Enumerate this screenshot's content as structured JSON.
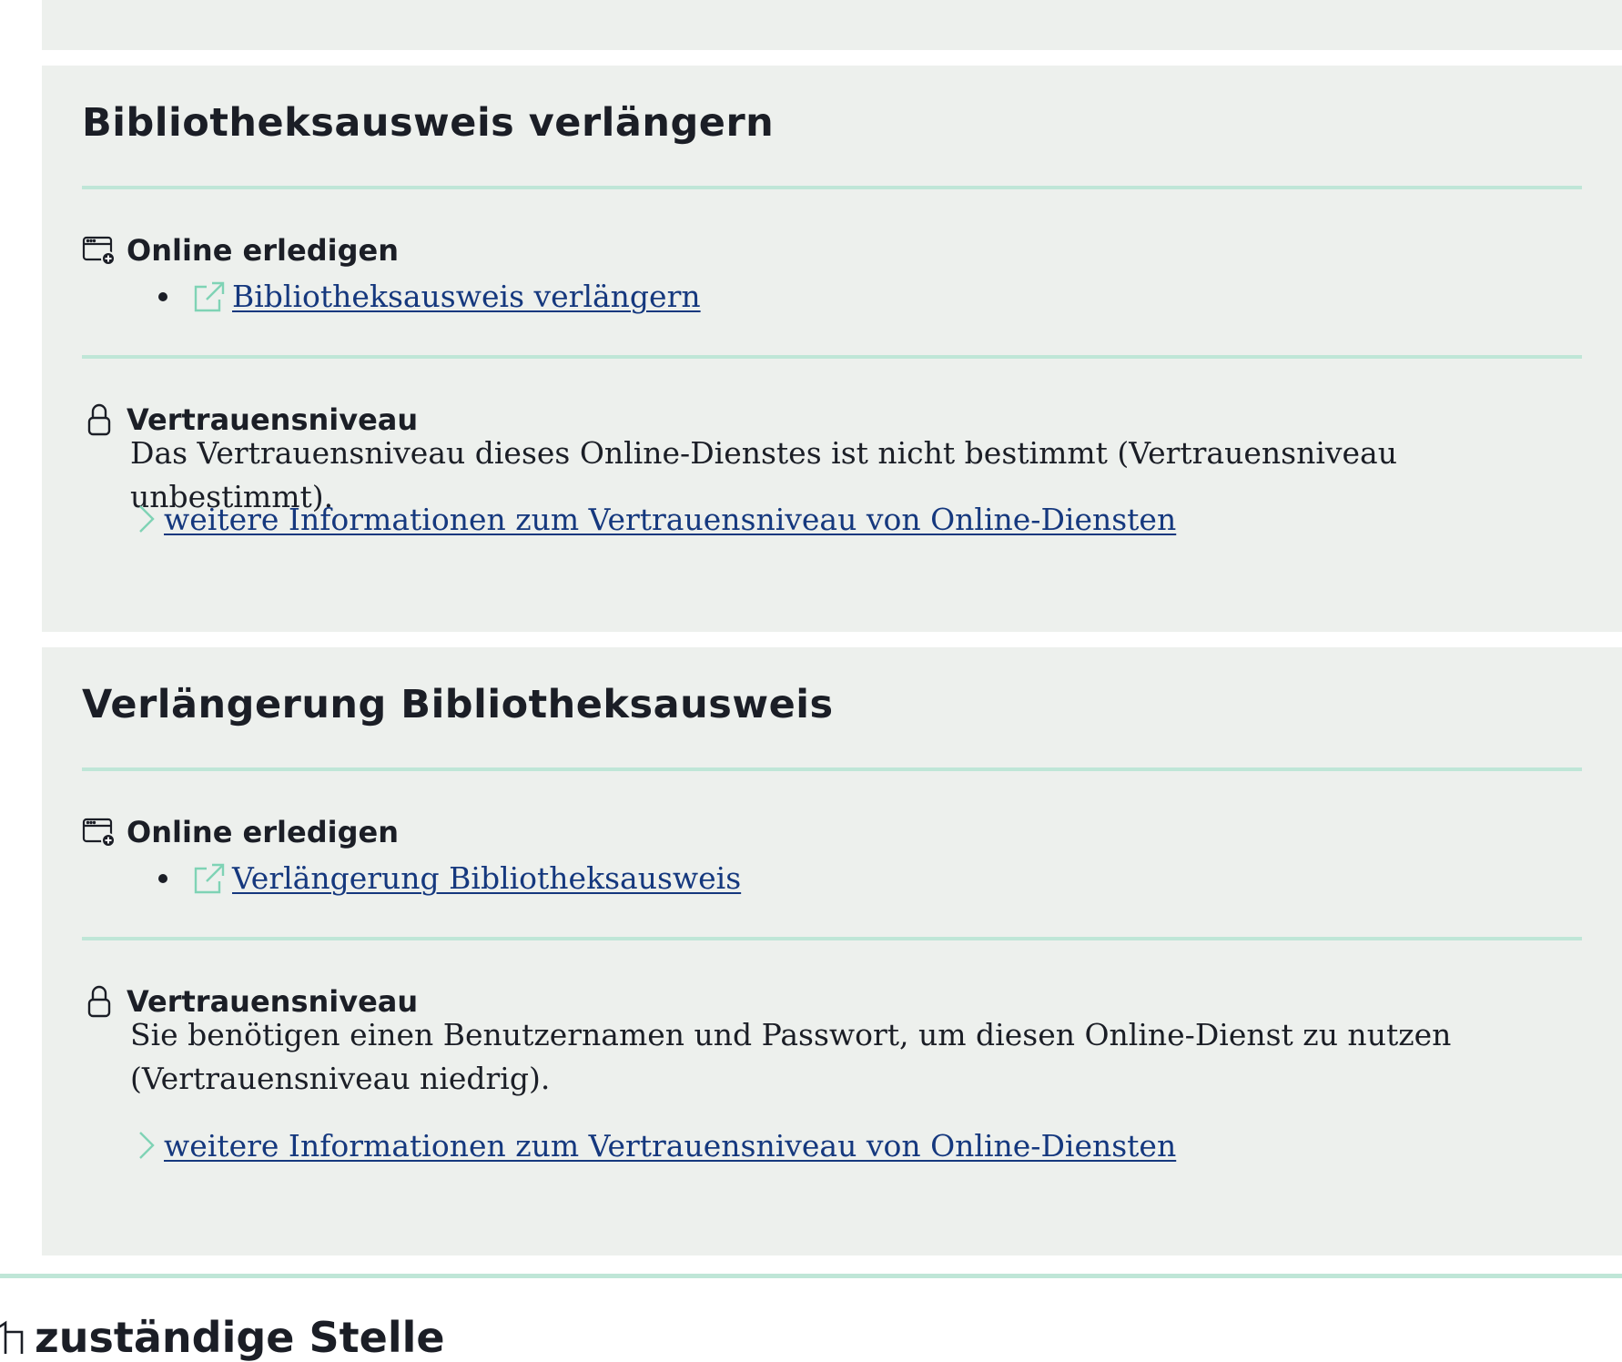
{
  "services": [
    {
      "title": "Bibliotheksausweis verlängern",
      "online_label": "Online erledigen",
      "online_link": "Bibliotheksausweis verlängern",
      "trust_label": "Vertrauensniveau",
      "trust_text": "Das Vertrauensniveau dieses Online-Dienstes ist nicht bestimmt (Vertrauensniveau unbestimmt).",
      "more_link": "weitere Informationen zum Vertrauensniveau von Online-Diensten"
    },
    {
      "title": "Verlängerung Bibliotheksausweis",
      "online_label": "Online erledigen",
      "online_link": "Verlängerung Bibliotheksausweis",
      "trust_label": "Vertrauensniveau",
      "trust_text": "Sie benötigen einen Benutzernamen und Passwort, um diesen Online-Dienst zu nutzen (Vertrauensniveau niedrig).",
      "more_link": "weitere Informationen zum Vertrauensniveau von Online-Diensten"
    }
  ],
  "next_section": {
    "label": "zuständige Stelle",
    "icon": "building-icon"
  },
  "icons": {
    "online": "browser-window-plus-icon",
    "external": "external-link-icon",
    "trust": "lock-icon",
    "more": "chevron-right-icon"
  },
  "colors": {
    "card_background": "#edf0ed",
    "divider": "#bfe6d7",
    "link": "#15387e",
    "icon_accent": "#7fd3b5",
    "text": "#1b1e26"
  }
}
